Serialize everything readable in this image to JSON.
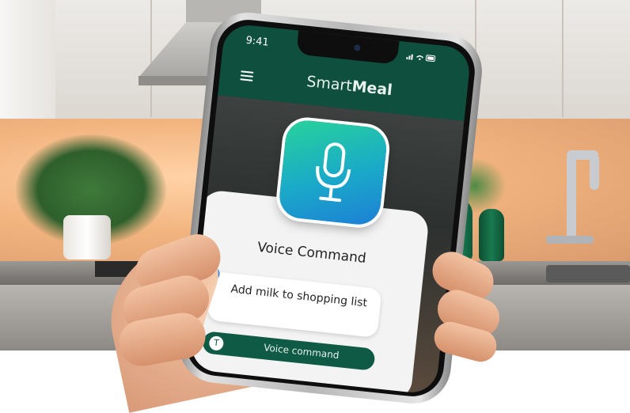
{
  "status_bar": {
    "time": "9:41",
    "icons": "signal wifi battery"
  },
  "app": {
    "title_light": "Smart",
    "title_bold": "Meal",
    "header_color": "#0f4f3e"
  },
  "voice_card": {
    "title": "Voice Command",
    "command_text": "Add milk to shopping list",
    "button_label": "Voice command",
    "mic_icon": "microphone-icon",
    "accent_color": "#1d7fd6",
    "button_color": "#0f5a45"
  }
}
